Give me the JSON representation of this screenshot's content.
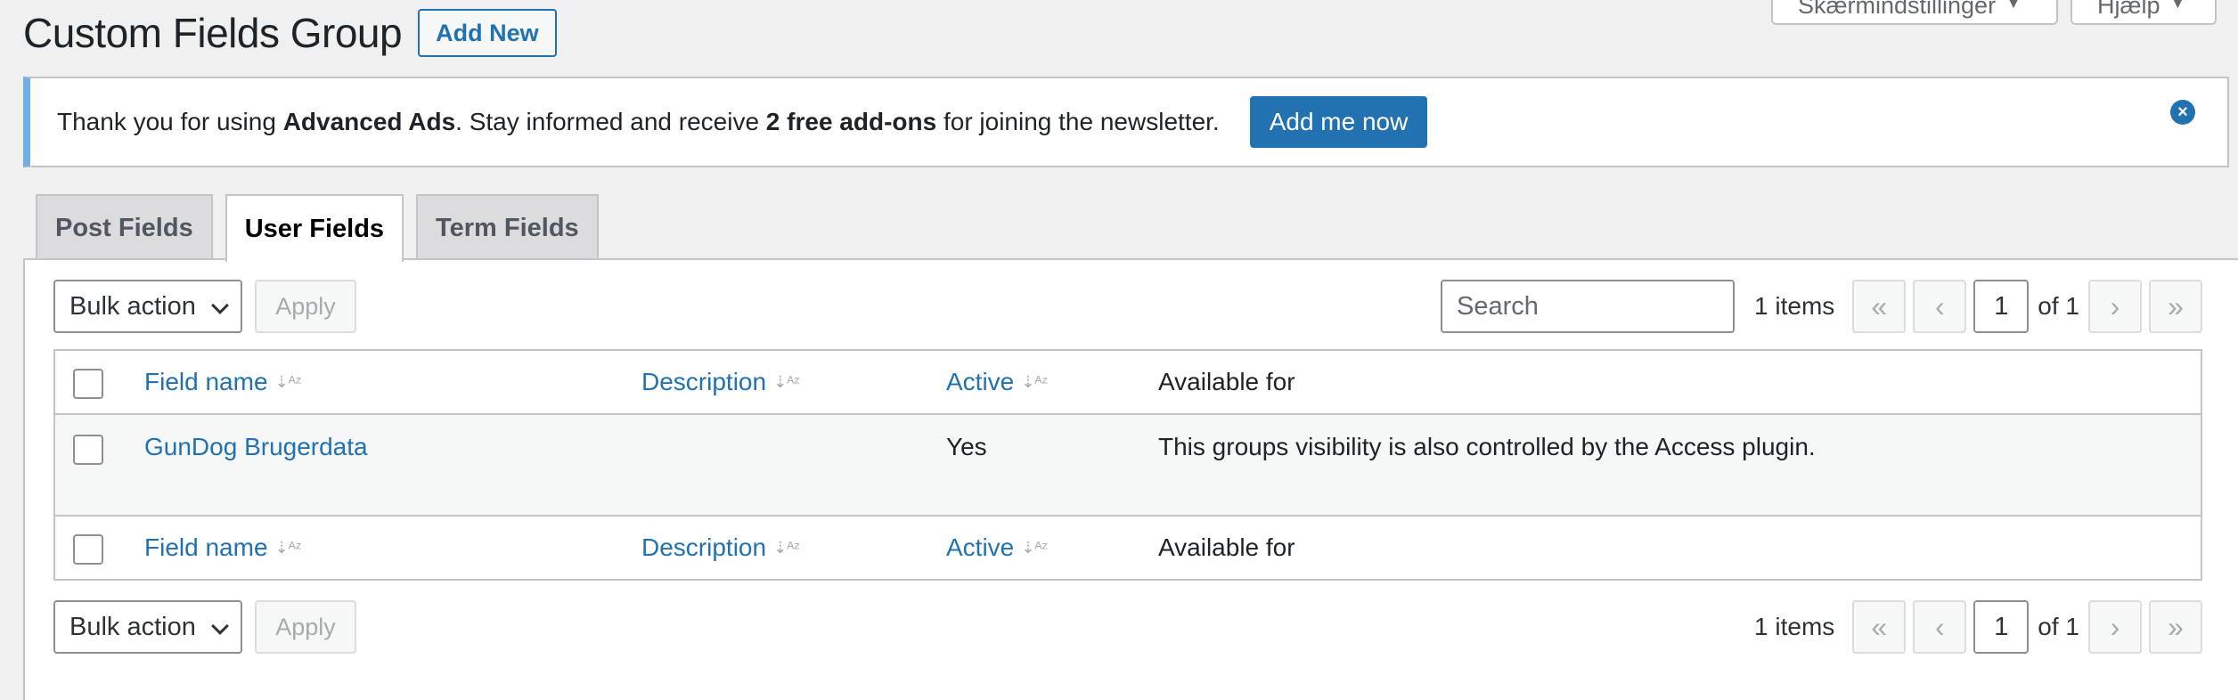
{
  "screen_meta": {
    "screen_options": "Skærmindstillinger",
    "help": "Hjælp"
  },
  "page": {
    "title": "Custom Fields Group",
    "add_new": "Add New"
  },
  "notice": {
    "text_before": "Thank you for using ",
    "brand": "Advanced Ads",
    "text_middle": ". Stay informed and receive ",
    "highlight": "2 free add-ons",
    "text_after": " for joining the newsletter.",
    "button": "Add me now",
    "close_icon": "close-circle-icon"
  },
  "tabs": [
    {
      "label": "Post Fields",
      "active": false
    },
    {
      "label": "User Fields",
      "active": true
    },
    {
      "label": "Term Fields",
      "active": false
    }
  ],
  "tablenav": {
    "bulk_action": "Bulk action",
    "apply": "Apply",
    "search_placeholder": "Search",
    "items_count": "1 items",
    "first": "«",
    "prev": "‹",
    "current_page": "1",
    "of_pages": "of 1",
    "next": "›",
    "last": "»"
  },
  "columns": {
    "field_name": "Field name",
    "description": "Description",
    "active": "Active",
    "available_for": "Available for"
  },
  "rows": [
    {
      "field_name": "GunDog Brugerdata",
      "description": "",
      "active": "Yes",
      "available_for": "This groups visibility is also controlled by the Access plugin."
    }
  ],
  "colors": {
    "accent": "#2271b1",
    "notice_border": "#72aee6",
    "background": "#f0f0f1"
  }
}
